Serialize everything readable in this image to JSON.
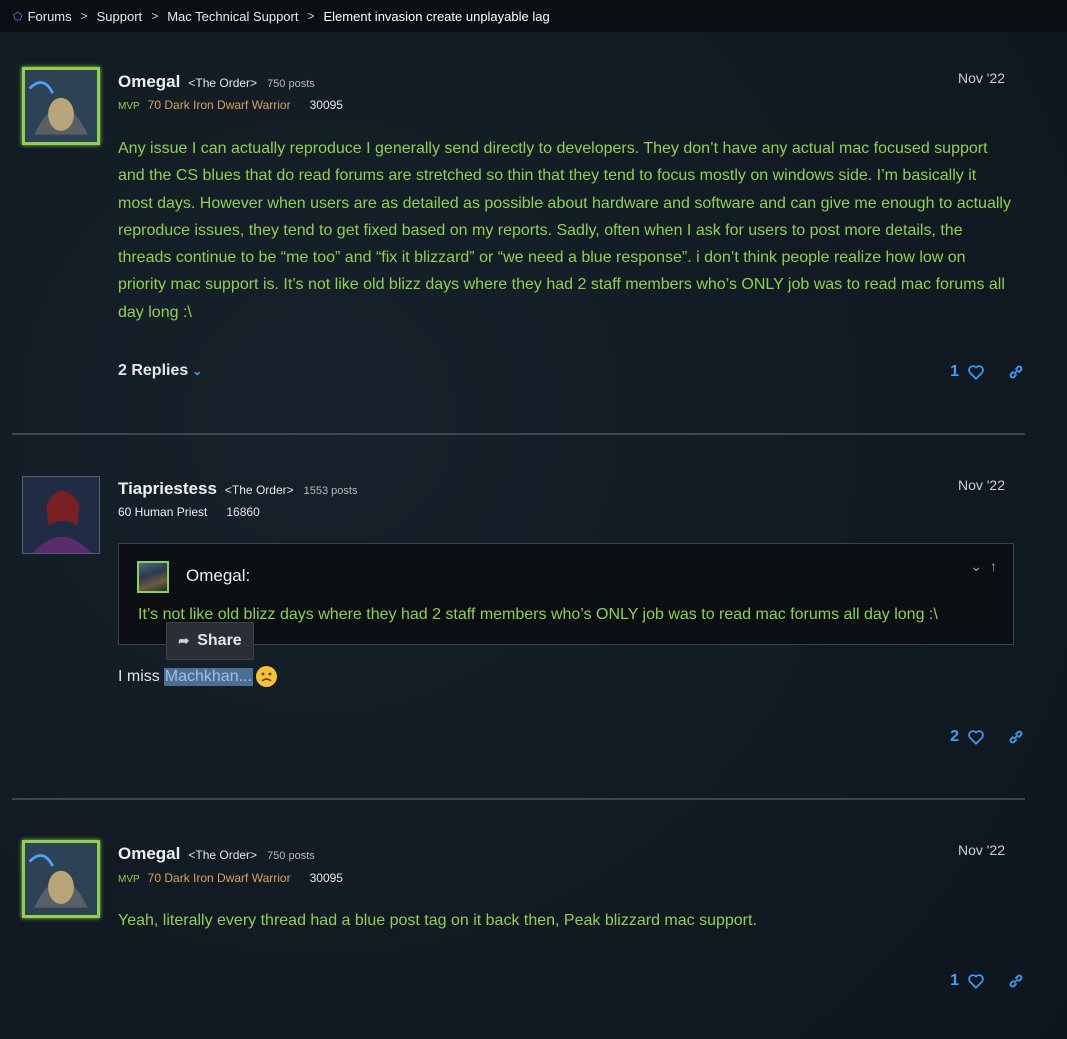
{
  "breadcrumb": {
    "items": [
      "Forums",
      "Support",
      "Mac Technical Support",
      "Element invasion create unplayable lag"
    ]
  },
  "posts": [
    {
      "username": "Omegal",
      "guild": "<The Order>",
      "post_count": "750 posts",
      "badge": "MVP",
      "char_info": "70 Dark Iron Dwarf Warrior",
      "achievement_points": "30095",
      "date": "Nov '22",
      "body": "Any issue I can actually reproduce I generally send directly to developers. They don’t have any actual mac focused support and the CS blues that do read forums are stretched so thin that they tend to focus mostly on windows side. I’m basically it most days. However when users are as detailed as possible about hardware and software and can give me enough to actually reproduce issues, they tend to get fixed based on my reports. Sadly, often when I ask for users to post more details, the threads continue to be “me too” and “fix it blizzard” or “we need a blue response”. i don’t think people realize how low on priority mac support is. It’s not like old blizz days where they had 2 staff members who’s ONLY job was to read mac forums all day long :\\",
      "replies_label": "2 Replies",
      "likes": "1"
    },
    {
      "username": "Tiapriestess",
      "guild": "<The Order>",
      "post_count": "1553 posts",
      "char_info": "60 Human Priest",
      "achievement_points": "16860",
      "date": "Nov '22",
      "quote": {
        "author": "Omegal:",
        "text": "It’s not like old blizz days where they had 2 staff members who’s ONLY job was to read mac forums all day long :\\"
      },
      "body_prefix": "I miss",
      "body_highlight": "Machkhan...",
      "likes": "2"
    },
    {
      "username": "Omegal",
      "guild": "<The Order>",
      "post_count": "750 posts",
      "badge": "MVP",
      "char_info": "70 Dark Iron Dwarf Warrior",
      "achievement_points": "30095",
      "date": "Nov '22",
      "body": "Yeah, literally every thread had a blue post tag on it back then, Peak blizzard mac support.",
      "likes": "1"
    }
  ],
  "share_popup": {
    "label": "Share"
  },
  "colors": {
    "background": "#111a22",
    "accent_blue": "#3aa0ff",
    "mvp_green": "#8fd14f",
    "warrior_tan": "#d9a05b",
    "selection": "#4d6e93"
  },
  "icons": [
    "home-icon",
    "chevron-right-icon",
    "chevron-down-icon",
    "heart-icon",
    "link-icon",
    "share-arrow-icon",
    "frown-emoji",
    "collapse-icon",
    "arrow-up-icon"
  ]
}
